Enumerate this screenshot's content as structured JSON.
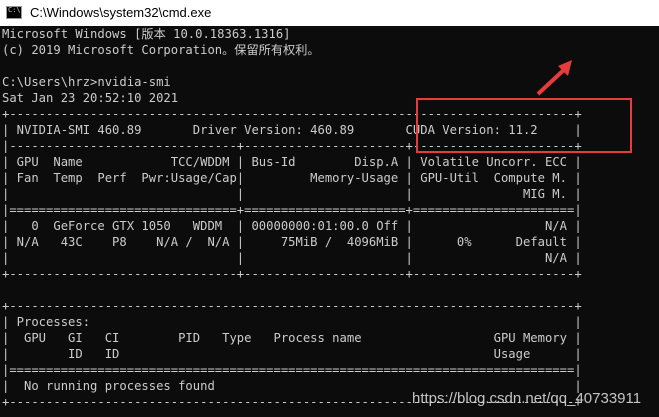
{
  "window": {
    "title": "C:\\Windows\\system32\\cmd.exe",
    "icon": "console-icon"
  },
  "console": {
    "lines": [
      "Microsoft Windows [版本 10.0.18363.1316]",
      "(c) 2019 Microsoft Corporation。保留所有权利。",
      "",
      "C:\\Users\\hrz>nvidia-smi",
      "Sat Jan 23 20:52:10 2021",
      "+-----------------------------------------------------------------------------+",
      "| NVIDIA-SMI 460.89       Driver Version: 460.89       CUDA Version: 11.2     |",
      "|-------------------------------+----------------------+----------------------+",
      "| GPU  Name            TCC/WDDM | Bus-Id        Disp.A | Volatile Uncorr. ECC |",
      "| Fan  Temp  Perf  Pwr:Usage/Cap|         Memory-Usage | GPU-Util  Compute M. |",
      "|                               |                      |               MIG M. |",
      "|===============================+======================+======================|",
      "|   0  GeForce GTX 1050   WDDM  | 00000000:01:00.0 Off |                  N/A |",
      "| N/A   43C    P8    N/A /  N/A |     75MiB /  4096MiB |      0%      Default |",
      "|                               |                      |                  N/A |",
      "+-------------------------------+----------------------+----------------------+",
      "",
      "+-----------------------------------------------------------------------------+",
      "| Processes:                                                                  |",
      "|  GPU   GI   CI        PID   Type   Process name                  GPU Memory |",
      "|        ID   ID                                                   Usage      |",
      "|=============================================================================|",
      "|  No running processes found                                                 |",
      "+-----------------------------------------------------------------------------+"
    ]
  },
  "annotation": {
    "highlight_color": "#e63c3c",
    "highlighted_text": "CUDA Version: 11.2"
  },
  "watermark": "https://blog.csdn.net/qq_40733911"
}
